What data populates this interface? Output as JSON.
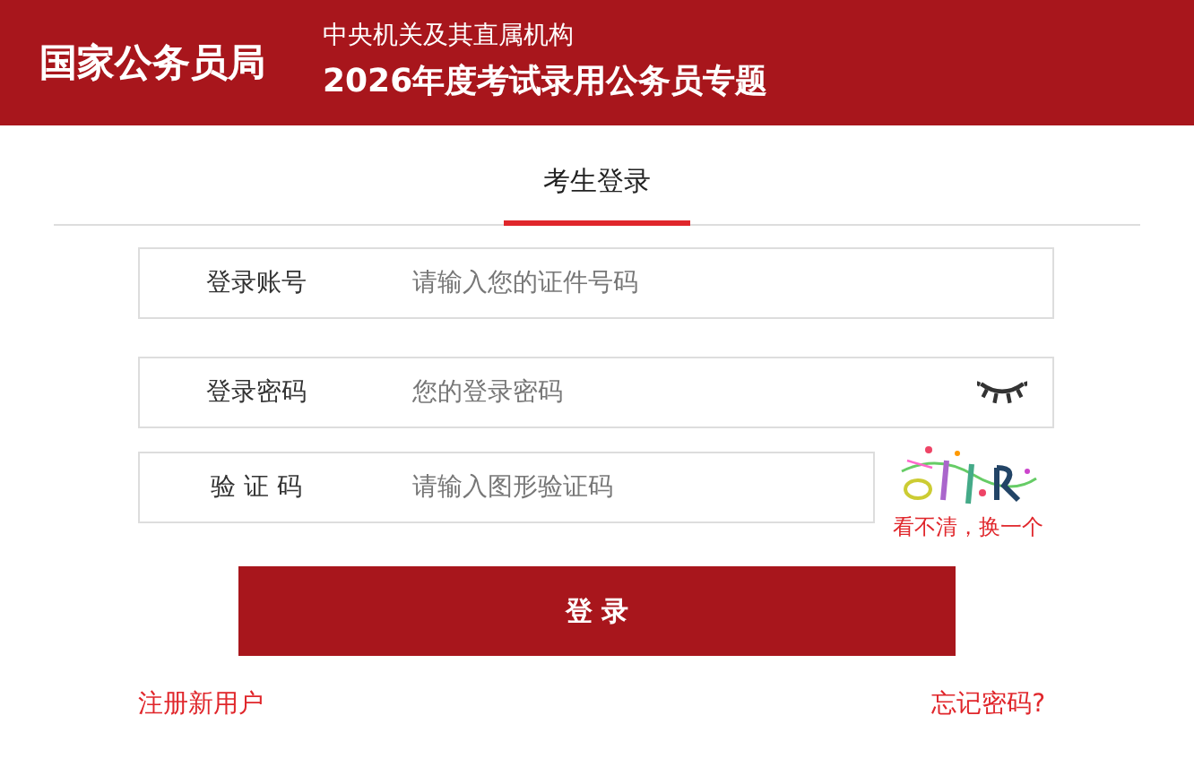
{
  "header": {
    "logo": "国家公务员局",
    "subtitle": "中央机关及其直属机构",
    "title": "2026年度考试录用公务员专题"
  },
  "tabs": [
    {
      "label": "考生登录",
      "selected": true
    }
  ],
  "fields": [
    {
      "kind": "text",
      "label": "登录账号",
      "placeholder": "请输入您的证件号码"
    },
    {
      "kind": "password",
      "label": "登录密码",
      "placeholder": "您的登录密码"
    },
    {
      "kind": "captcha",
      "label": "验 证 码",
      "placeholder": "请输入图形验证码",
      "refresh": "看不清，换一个"
    }
  ],
  "submit": "登 录",
  "links": [
    "注册新用户",
    "忘记密码?"
  ]
}
